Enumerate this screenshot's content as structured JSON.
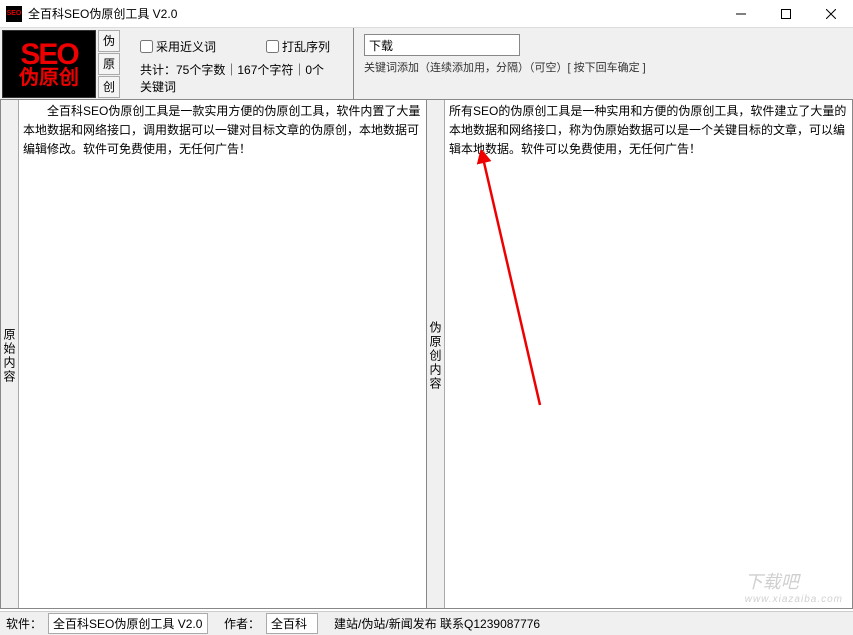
{
  "title": "全百科SEO伪原创工具 V2.0",
  "logo": {
    "main": "SEO",
    "sub": "伪原创"
  },
  "actions": {
    "wei": "伪",
    "yuan": "原",
    "chuang": "创"
  },
  "options": {
    "synonym": "采用近义词",
    "shuffle": "打乱序列"
  },
  "stats": "共计：75个字数｜167个字符｜0个关键词",
  "keyword": {
    "value": "下载",
    "hint": "关键词添加（连续添加用，分隔）（可空）[ 按下回车确定 ]"
  },
  "panels": {
    "left_label": "原始内容",
    "right_label": "伪原创内容",
    "left_text": "全百科SEO伪原创工具是一款实用方便的伪原创工具，软件内置了大量本地数据和网络接口，调用数据可以一键对目标文章的伪原创，本地数据可编辑修改。软件可免费使用，无任何广告！",
    "right_text": "所有SEO的伪原创工具是一种实用和方便的伪原创工具，软件建立了大量的本地数据和网络接口，称为伪原始数据可以是一个关键目标的文章，可以编辑本地数据。软件可以免费使用，无任何广告！"
  },
  "status": {
    "software_label": "软件：",
    "software_value": "全百科SEO伪原创工具 V2.0",
    "author_label": "作者：",
    "author_value": "全百科",
    "extra": "建站/伪站/新闻发布 联系Q1239087776"
  },
  "watermark": {
    "main": "下载吧",
    "sub": "www.xiazaiba.com"
  }
}
